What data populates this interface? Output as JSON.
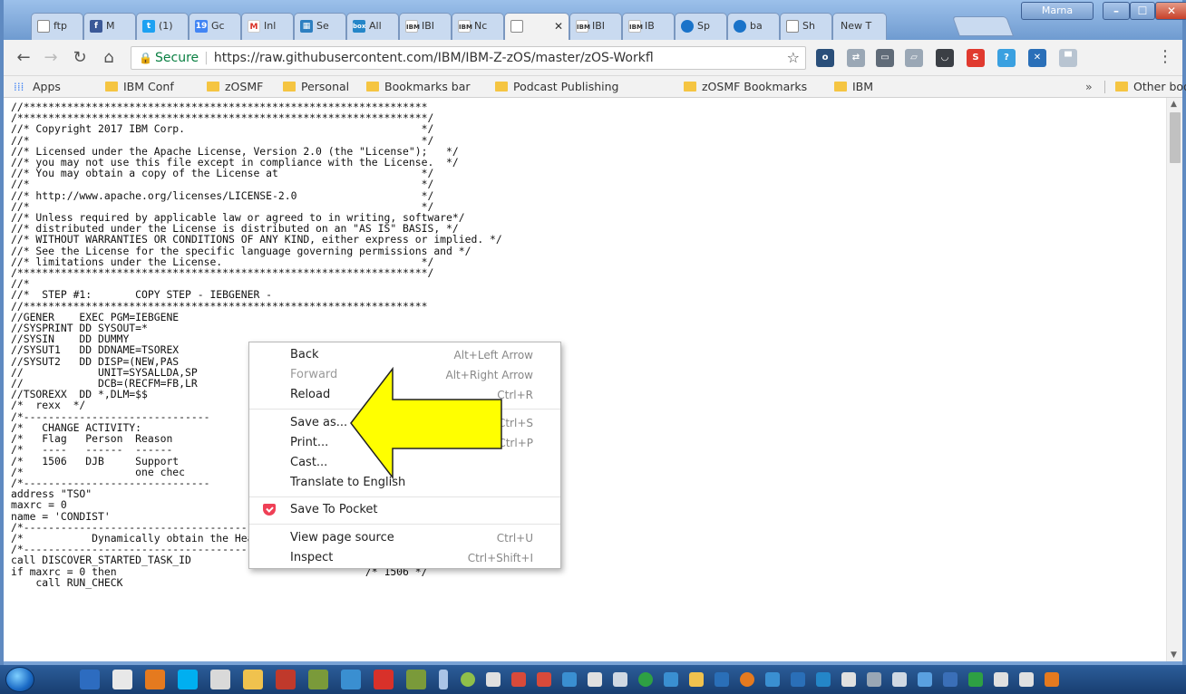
{
  "browser": {
    "tabs": [
      {
        "label": "ftp",
        "icon": "doc"
      },
      {
        "label": "M",
        "icon": "facebook"
      },
      {
        "label": "(1)",
        "icon": "twitter"
      },
      {
        "label": "Gc",
        "icon": "calendar"
      },
      {
        "label": "Inl",
        "icon": "gmail"
      },
      {
        "label": "Se",
        "icon": "grid"
      },
      {
        "label": "All",
        "icon": "box"
      },
      {
        "label": "IBI",
        "icon": "ibm"
      },
      {
        "label": "Nc",
        "icon": "ibm"
      },
      {
        "label": "",
        "icon": "doc",
        "active": true
      },
      {
        "label": "IBI",
        "icon": "ibm"
      },
      {
        "label": "IB",
        "icon": "ibm"
      },
      {
        "label": "Sp",
        "icon": "globe"
      },
      {
        "label": "ba",
        "icon": "globe"
      },
      {
        "label": "Sh",
        "icon": "doc"
      },
      {
        "label": "New T",
        "icon": "none"
      }
    ],
    "profile_label": "Marna",
    "secure_label": "Secure",
    "url": "https://raw.githubusercontent.com/IBM/IBM-Z-zOS/master/zOS-Workfl"
  },
  "bookmarks": {
    "items": [
      "Apps",
      "IBM Conf",
      "zOSMF",
      "Personal",
      "Bookmarks bar",
      "Podcast Publishing",
      "zOSMF Bookmarks",
      "IBM"
    ],
    "overflow": "»",
    "other": "Other bookmarks"
  },
  "content": {
    "lines": [
      "//*****************************************************************",
      "/******************************************************************/",
      "//* Copyright 2017 IBM Corp.                                      */",
      "//*                                                               */",
      "//* Licensed under the Apache License, Version 2.0 (the \"License\");   */",
      "//* you may not use this file except in compliance with the License.  */",
      "//* You may obtain a copy of the License at                       */",
      "//*                                                               */",
      "//* http://www.apache.org/licenses/LICENSE-2.0                    */",
      "//*                                                               */",
      "//* Unless required by applicable law or agreed to in writing, software*/",
      "//* distributed under the License is distributed on an \"AS IS\" BASIS, */",
      "//* WITHOUT WARRANTIES OR CONDITIONS OF ANY KIND, either express or implied. */",
      "//* See the License for the specific language governing permissions and */",
      "//* limitations under the License.                                */",
      "/******************************************************************/",
      "//*",
      "//*  STEP #1:       COPY STEP - IEBGENER -",
      "//*****************************************************************",
      "//GENER    EXEC PGM=IEBGENE",
      "//SYSPRINT DD SYSOUT=*",
      "//SYSIN    DD DUMMY",
      "//SYSUT1   DD DDNAME=TSOREX",
      "//SYSUT2   DD DISP=(NEW,PAS",
      "//            UNIT=SYSALLDA,SP",
      "//            DCB=(RECFM=FB,LR",
      "//TSOREXX  DD *,DLM=$$",
      "/*  rexx  */",
      "/*------------------------------                    --------------------*/",
      "/*   CHANGE ACTIVITY:                                                   */",
      "/*   Flag   Person  Reason                                              */",
      "/*   ----   ------  ------                            ----------------*/",
      "/*   1506   DJB     Support                                        than*/",
      "/*                  one chec                                            */",
      "/*------------------------------                    --------------------*/",
      "address \"TSO\"",
      "maxrc = 0                                                /* 1506 */",
      "name = 'CONDIST'",
      "/*-------------------------------------------------------------------*/",
      "/*           Dynamically obtain the Health Checker Task ID          */",
      "/*-------------------------------------------------------------------*/",
      "call DISCOVER_STARTED_TASK_ID",
      "if maxrc = 0 then                                        /* 1506 */",
      "    call RUN_CHECK"
    ]
  },
  "context_menu": {
    "items": [
      {
        "label": "Back",
        "shortcut": "Alt+Left Arrow",
        "disabled": false
      },
      {
        "label": "Forward",
        "shortcut": "Alt+Right Arrow",
        "disabled": true
      },
      {
        "label": "Reload",
        "shortcut": "Ctrl+R",
        "disabled": false
      },
      {
        "label": "Save as...",
        "shortcut": "Ctrl+S",
        "disabled": false
      },
      {
        "label": "Print...",
        "shortcut": "Ctrl+P",
        "disabled": false
      },
      {
        "label": "Cast...",
        "shortcut": "",
        "disabled": false
      },
      {
        "label": "Translate to English",
        "shortcut": "",
        "disabled": false
      },
      {
        "label": "Save To Pocket",
        "shortcut": "",
        "disabled": false
      },
      {
        "label": "View page source",
        "shortcut": "Ctrl+U",
        "disabled": false
      },
      {
        "label": "Inspect",
        "shortcut": "Ctrl+Shift+I",
        "disabled": false
      }
    ]
  },
  "colors": {
    "arrow_fill": "#ffff00",
    "secure_green": "#0b8043",
    "pocket_red": "#ef4056"
  }
}
